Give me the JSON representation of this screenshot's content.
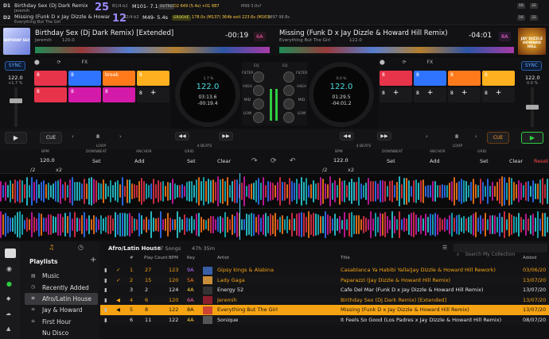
{
  "status": {
    "d1": {
      "label": "D1",
      "title": "Birthday Sex (Dj Dark Remix) [Extended]",
      "artist": "Jeremih",
      "big": "25",
      "beat": "B1/4-b2",
      "loop": "M101- 7.1s",
      "badge": "OUTRO",
      "meta": "D2 649 (5.4s) +01 687",
      "next": "M99 3.0s?"
    },
    "d2": {
      "label": "D2",
      "title": "Missing (Funk D x Jay Dizzle & Howard Hill Remix)",
      "artist": "Everything But The Girl",
      "big": "12",
      "beat": "B2/4-b2",
      "loop": "M49- 5.4s",
      "badge": "GROOVE",
      "meta": "178.0s (M137)  364b  exit 223.6s (M163)",
      "next": "M97 98.8s"
    },
    "right_tags": [
      "16",
      "32"
    ]
  },
  "deck1": {
    "title": "Birthday Sex (Dj Dark Remix) [Extended]",
    "artist": "Jeremih",
    "bpm": "120.0",
    "time": "-00:19",
    "key": "6A",
    "sync": "SYNC",
    "tempo": "122.0",
    "pitch": "+1.7 %",
    "jog": {
      "pct": "1.7 %",
      "bpm": "122.0",
      "elapsed": "03:13.6",
      "remain": "-00:19.4"
    },
    "pads_top": [
      "8",
      "8",
      "break",
      "8"
    ],
    "pads_bot": [
      "8",
      "8",
      "8",
      "8"
    ],
    "cue": "CUE",
    "loop": "8",
    "loop_label": "LOOP",
    "beats": "4 BEATS",
    "grid": {
      "bpm_label": "BPM",
      "bpm": "120.0",
      "downbeat": "DOWNBEAT",
      "anchor": "ANCHOR",
      "gridl": "GRID",
      "set": "Set",
      "add": "Add",
      "clear": "Clear",
      "fraction": "/2",
      "mult": "x2"
    }
  },
  "deck2": {
    "title": "Missing (Funk D x Jay Dizzle & Howard Hill Remix)",
    "artist": "Everything But The Girl",
    "bpm": "122.0",
    "time": "-04:01",
    "key": "8A",
    "sync": "SYNC",
    "tempo": "122.0",
    "pitch": "0.0 %",
    "jog": {
      "pct": "0.0 %",
      "bpm": "122.0",
      "elapsed": "01:29.5",
      "remain": "-04:01.2"
    },
    "pads_top": [
      "8",
      "8",
      "8",
      "8"
    ],
    "pads_bot": [
      "8",
      "8",
      "8",
      "8"
    ],
    "cue": "CUE",
    "loop": "8",
    "loop_label": "LOOP",
    "beats": "4 BEATS",
    "reset": "Reset",
    "grid": {
      "bpm_label": "BPM",
      "bpm": "122.0",
      "downbeat": "DOWNBEAT",
      "anchor": "ANCHOR",
      "gridl": "GRID",
      "set": "Set",
      "add": "Add",
      "clear": "Clear",
      "fraction": "/2",
      "mult": "x2"
    }
  },
  "mixer": {
    "eq": "EQ",
    "filter": "FILTER",
    "high": "HIGH",
    "mid": "MID",
    "low": "LOW"
  },
  "colors": {
    "red": "#e8344a",
    "blue": "#2f74ff",
    "orange": "#ff7a1a",
    "amber": "#ffb01f",
    "magenta": "#d41aa8",
    "teal": "#19b9c4",
    "cyan": "#2dd4e0",
    "selected": "#f6a313",
    "green": "#2ecc40"
  },
  "library": {
    "playlists_title": "Playlists",
    "playlists": [
      "Music",
      "Recently Added",
      "Afro/Latin House",
      "Jay & Howard",
      "First Hour",
      "Nu Disco"
    ],
    "current": "Afro/Latin House",
    "songs": "567 Songs",
    "duration": "47h 35m",
    "search_placeholder": "Search My Collection",
    "columns": [
      "#",
      "Play Count",
      "BPM",
      "Key",
      "Artist",
      "Title",
      "Added"
    ],
    "rows": [
      {
        "n": "1",
        "pc": "27",
        "bpm": "123",
        "key": "9A",
        "artist": "Gipsy kings & Alabina",
        "title": "Casablanca Ya Habibi Yalla(Jay Dizzle & Howard Hill Rework)",
        "added": "03/06/20"
      },
      {
        "n": "2",
        "pc": "15",
        "bpm": "120",
        "key": "5A",
        "artist": "Lady Gaga",
        "title": "Paparazzi (Jay Dizzle & Howard Hill Remix)",
        "added": "13/07/20"
      },
      {
        "n": "3",
        "pc": "2",
        "bpm": "124",
        "key": "4A",
        "artist": "Energy 52",
        "title": "Cafe Del Mar (Funk D x Jay Dizzle & Howard Hill Remix)",
        "added": "13/07/20"
      },
      {
        "n": "4",
        "pc": "6",
        "bpm": "120",
        "key": "6A",
        "artist": "Jeremih",
        "title": "Birthday Sex (Dj Dark Remix) [Extended]",
        "added": "13/07/20"
      },
      {
        "n": "5",
        "pc": "8",
        "bpm": "122",
        "key": "8A",
        "artist": "Everything But The Girl",
        "title": "Missing (Funk D x Jay Dizzle & Howard Hill Remix)",
        "added": "13/07/20"
      },
      {
        "n": "6",
        "pc": "11",
        "bpm": "122",
        "key": "4A",
        "artist": "Sonique",
        "title": "It Feels So Good (Los Padres x Jay Dizzle & Howard Hill Remix)",
        "added": "08/07/20"
      }
    ]
  }
}
